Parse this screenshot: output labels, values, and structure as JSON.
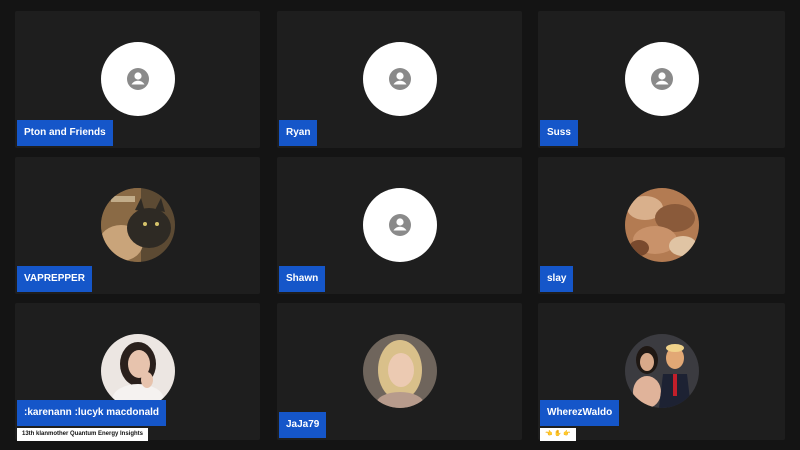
{
  "participants": [
    {
      "name": "Pton and Friends",
      "avatar": "person-placeholder-icon"
    },
    {
      "name": "Ryan",
      "avatar": "person-placeholder-icon"
    },
    {
      "name": "Suss",
      "avatar": "person-placeholder-icon"
    },
    {
      "name": "VAPREPPER",
      "avatar": "photo-cat-and-person"
    },
    {
      "name": "Shawn",
      "avatar": "person-placeholder-icon"
    },
    {
      "name": "slay",
      "avatar": "photo-copper-texture"
    },
    {
      "name": ":karenann :lucyk macdonald",
      "avatar": "photo-woman-dark-hair",
      "subtitle": "13th klanmother Quantum Energy Insights"
    },
    {
      "name": "JaJa79",
      "avatar": "photo-blonde-woman"
    },
    {
      "name": "WherezWaldo",
      "avatar": "photo-couple",
      "subtitle": "👈 ✋ 👉"
    }
  ],
  "colors": {
    "background": "#141414",
    "tile": "#1e1e1e",
    "name_tag": "#1556c9",
    "avatar_placeholder": "#ffffff"
  }
}
